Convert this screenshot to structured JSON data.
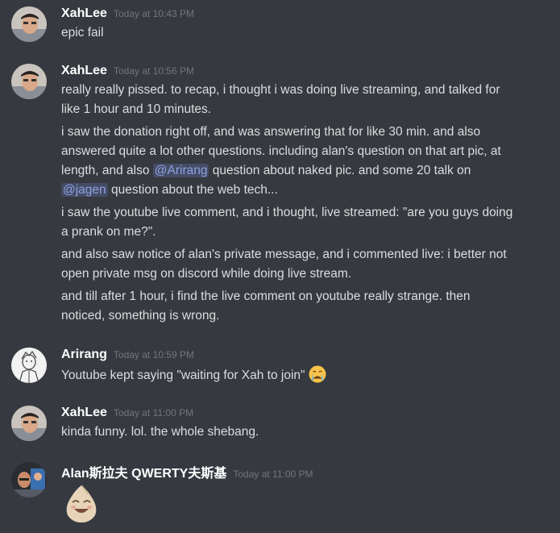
{
  "messages": [
    {
      "author": "XahLee",
      "time": "Today at 10:43 PM",
      "lines": [
        "epic fail"
      ]
    },
    {
      "author": "XahLee",
      "time": "Today at 10:56 PM",
      "lines": [
        "really really pissed. to recap, i thought i was doing live streaming, and talked for",
        "like 1 hour and 10 minutes.",
        "i saw the donation right off, and was answering that for like 30 min. and also",
        "answered quite a lot other questions. including alan's question on that art pic, at",
        "length, and also",
        "question about naked pic. and some 20 talk on",
        "question about the web tech...",
        "i saw the youtube live comment, and i thought, live streamed: \"are you guys doing",
        "a prank on me?\".",
        "and also saw notice of alan's private message, and i commented live: i better not",
        "open private msg on discord while doing live stream.",
        "and till after 1 hour, i find the live comment on youtube really strange. then",
        "noticed, something is wrong."
      ],
      "mentions": [
        "@Arirang",
        "@jagen"
      ]
    },
    {
      "author": "Arirang",
      "time": "Today at 10:59 PM",
      "lines": [
        "Youtube kept saying \"waiting for Xah to join\""
      ],
      "emoji": "crying-face"
    },
    {
      "author": "XahLee",
      "time": "Today at 11:00 PM",
      "lines": [
        "kinda funny. lol. the whole shebang."
      ]
    },
    {
      "author": "Alan斯拉夫 QWERTY夫斯基",
      "time": "Today at 11:00 PM",
      "sticker": "laughing-face-sticker"
    }
  ],
  "colors": {
    "background": "#36393f",
    "author": "#ffffff",
    "timestamp": "#72767d",
    "text": "#dcddde",
    "mention": "#8ea1e1"
  }
}
